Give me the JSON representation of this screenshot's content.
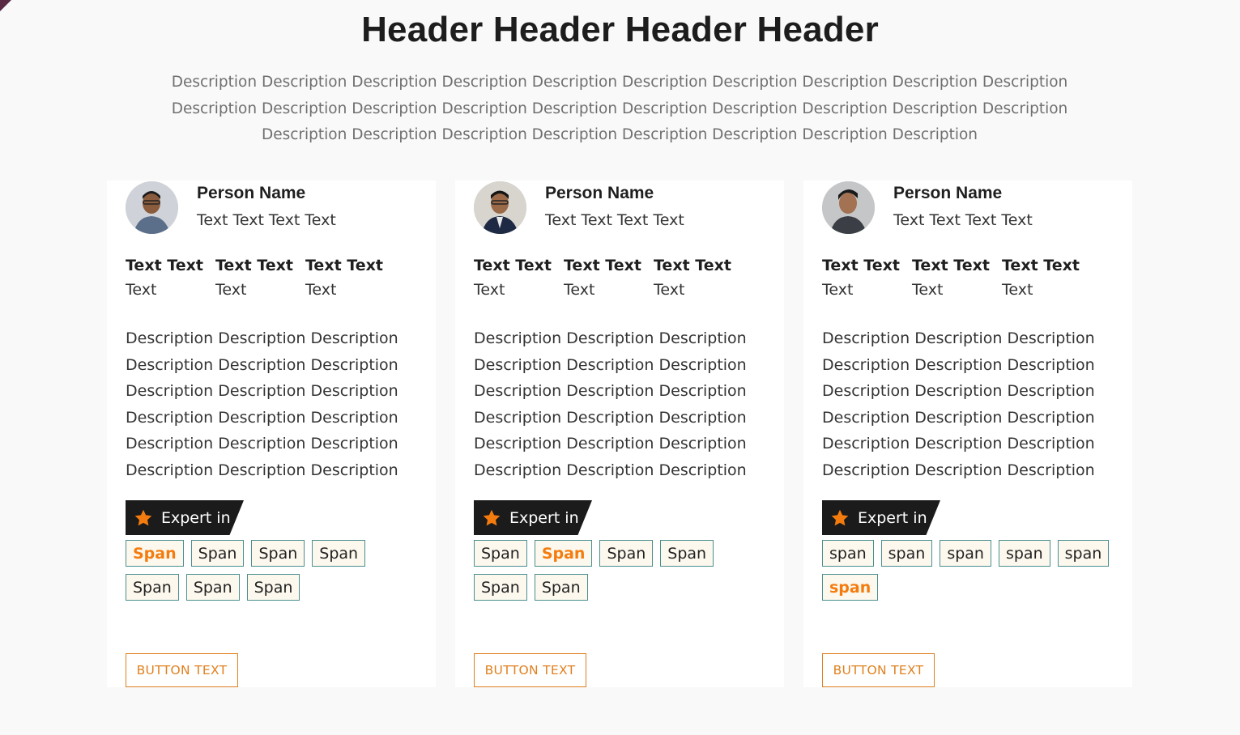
{
  "page": {
    "header": "Header Header Header Header",
    "description": "Description Description Description Description Description Description Description Description Description Description Description Description Description Description Description Description Description Description Description Description Description Description Description Description Description Description Description Description"
  },
  "colors": {
    "accent": "#f47c0f",
    "tag_border": "#4a8f8f",
    "badge_bg": "#1b1b1b"
  },
  "cards": [
    {
      "name": "Person Name",
      "role": "Text Text Text Text",
      "stats": [
        {
          "label": "Text Text",
          "value": "Text"
        },
        {
          "label": "Text Text",
          "value": "Text"
        },
        {
          "label": "Text Text",
          "value": "Text"
        }
      ],
      "description": "Description Description Description Description Description Description Description Description Description Description Description Description Description Description Description Description Description Description",
      "expert_label": "Expert in",
      "tags": [
        "Span",
        "Span",
        "Span",
        "Span",
        "Span",
        "Span",
        "Span"
      ],
      "active_tag": 0,
      "button": "BUTTON TEXT"
    },
    {
      "name": "Person Name",
      "role": "Text Text Text Text",
      "stats": [
        {
          "label": "Text Text",
          "value": "Text"
        },
        {
          "label": "Text Text",
          "value": "Text"
        },
        {
          "label": "Text Text",
          "value": "Text"
        }
      ],
      "description": "Description Description Description Description Description Description Description Description Description Description Description Description Description Description Description Description Description Description",
      "expert_label": "Expert in",
      "tags": [
        "Span",
        "Span",
        "Span",
        "Span",
        "Span",
        "Span"
      ],
      "active_tag": 1,
      "button": "BUTTON TEXT"
    },
    {
      "name": "Person Name",
      "role": "Text Text Text Text",
      "stats": [
        {
          "label": "Text Text",
          "value": "Text"
        },
        {
          "label": "Text Text",
          "value": "Text"
        },
        {
          "label": "Text Text",
          "value": "Text"
        }
      ],
      "description": "Description Description Description Description Description Description Description Description Description Description Description Description Description Description Description Description Description Description",
      "expert_label": "Expert in",
      "tags": [
        "span",
        "span",
        "span",
        "span",
        "span",
        "span"
      ],
      "active_tag": 5,
      "button": "BUTTON TEXT"
    }
  ]
}
